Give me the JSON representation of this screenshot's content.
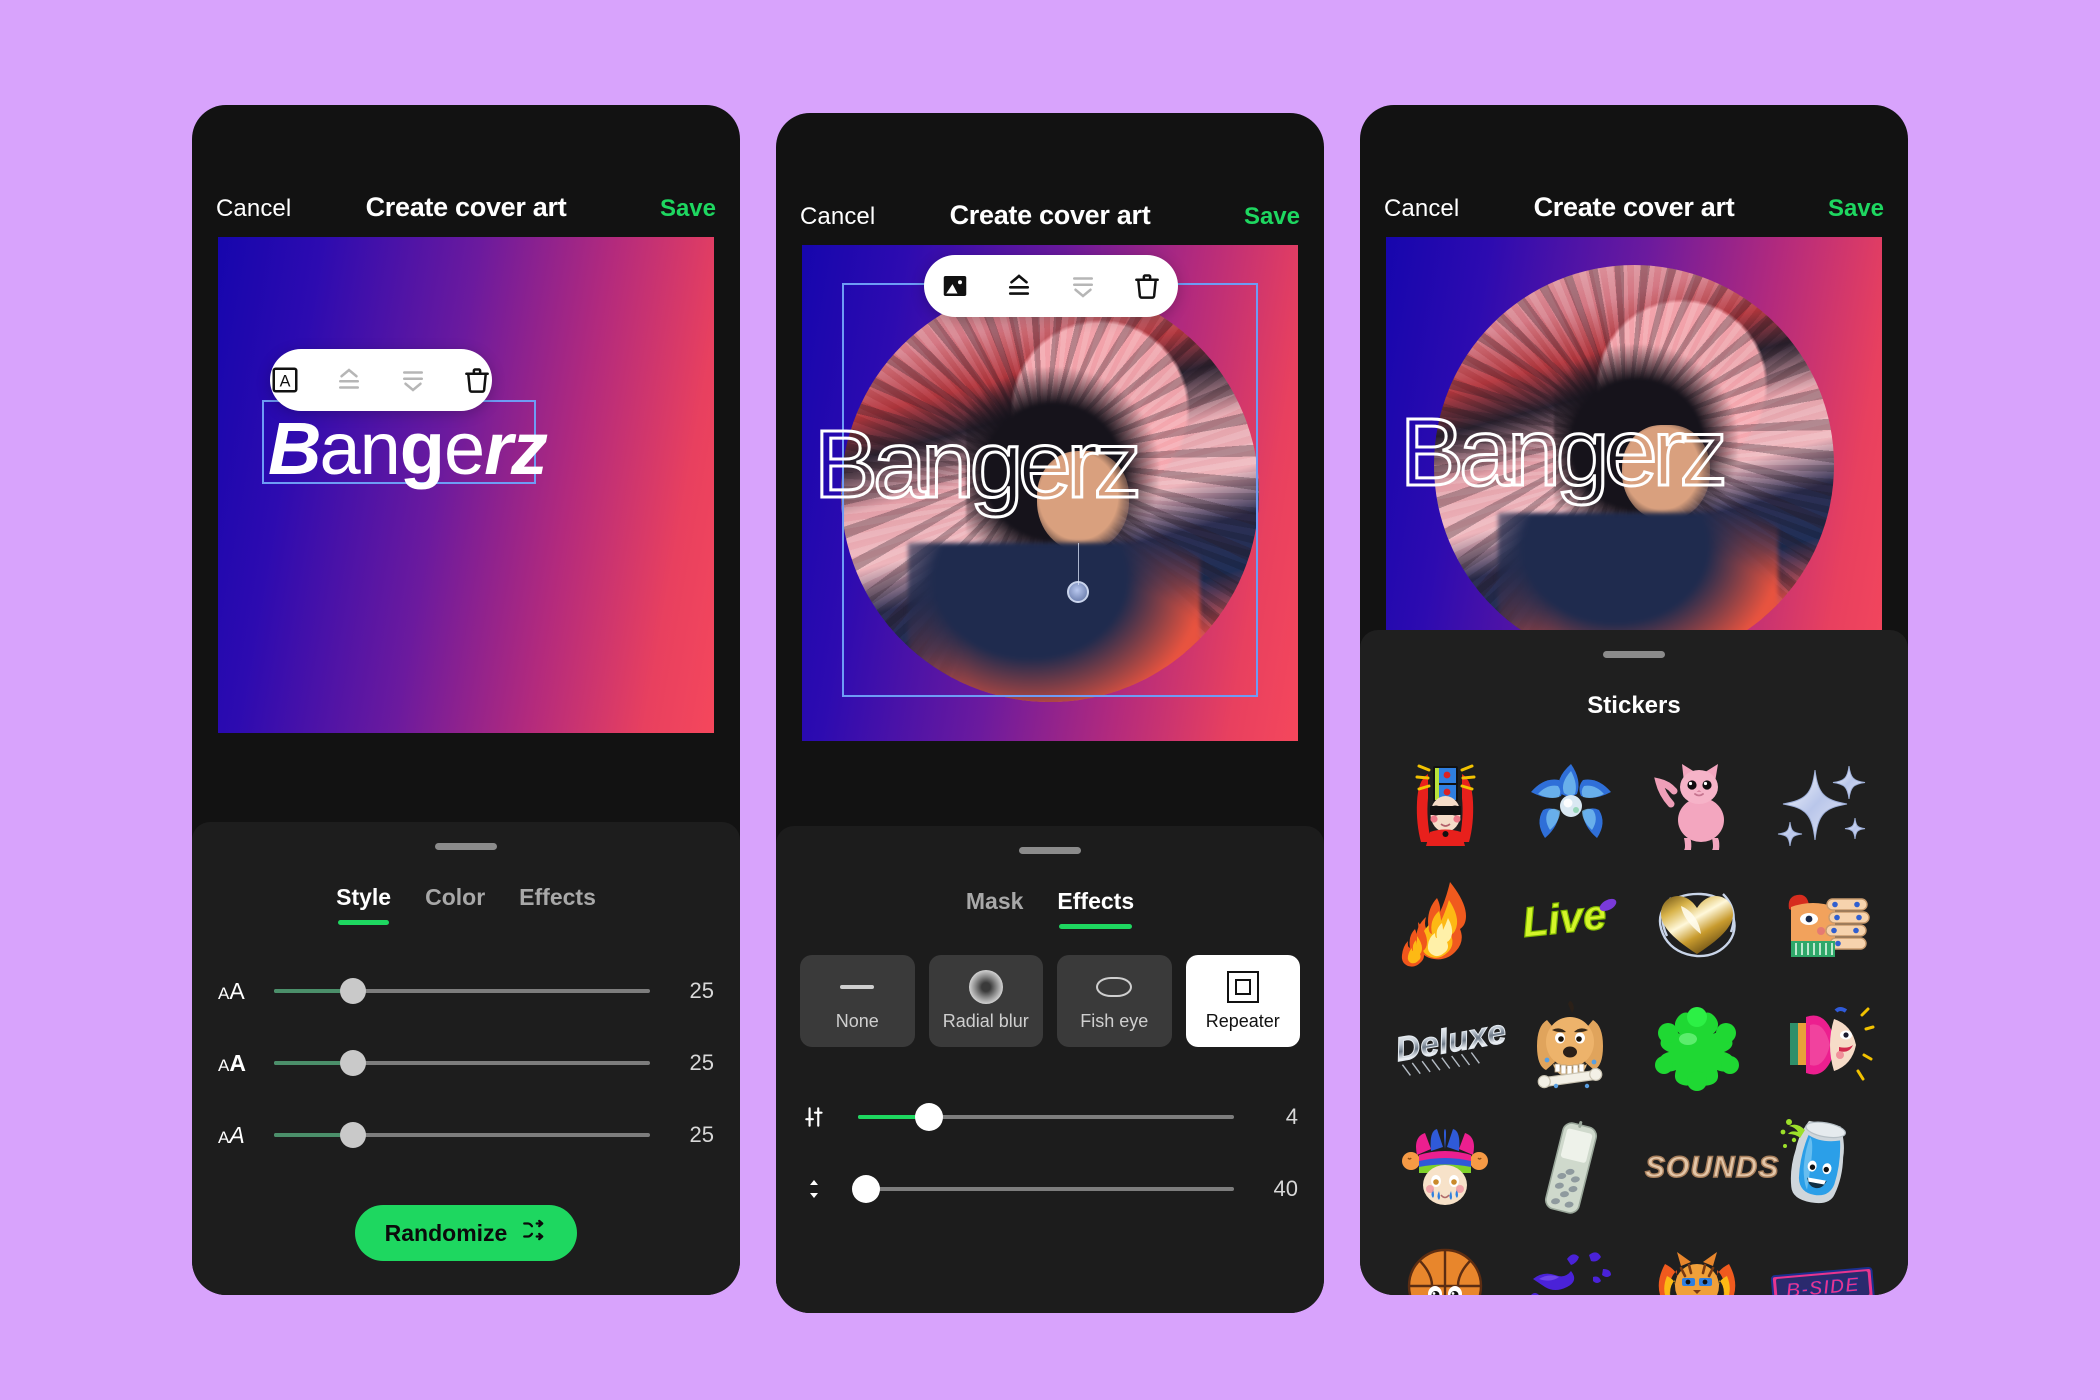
{
  "background_color": "#d8a3fc",
  "accent_green": "#1ed760",
  "screens": [
    {
      "id": "text-style",
      "header": {
        "cancel": "Cancel",
        "title": "Create cover art",
        "save": "Save"
      },
      "canvas": {
        "type": "gradient",
        "gradient_from": "#1606ad",
        "gradient_to": "#f5475c",
        "text_layer": {
          "value": "Bangerz",
          "parts": [
            "B",
            "an",
            "g",
            "e",
            "rz"
          ],
          "selected": true
        }
      },
      "toolbar": {
        "items": [
          {
            "icon": "text-box-icon",
            "label": "Text",
            "active": true
          },
          {
            "icon": "bring-forward-icon",
            "label": "Bring forward",
            "active": false
          },
          {
            "icon": "send-backward-icon",
            "label": "Send backward",
            "active": false
          },
          {
            "icon": "trash-icon",
            "label": "Delete",
            "active": true
          }
        ]
      },
      "sheet": {
        "tabs": [
          {
            "label": "Style",
            "active": true
          },
          {
            "label": "Color",
            "active": false
          },
          {
            "label": "Effects",
            "active": false
          }
        ],
        "sliders": [
          {
            "icon": "font-width-icon",
            "icon_text": "AA",
            "value": "25",
            "percent": 21
          },
          {
            "icon": "font-weight-icon",
            "icon_text": "AA",
            "value": "25",
            "percent": 21
          },
          {
            "icon": "font-slant-icon",
            "icon_text": "AA",
            "value": "25",
            "percent": 21
          }
        ],
        "randomize": {
          "label": "Randomize",
          "icon": "shuffle-icon"
        }
      }
    },
    {
      "id": "image-effects",
      "header": {
        "cancel": "Cancel",
        "title": "Create cover art",
        "save": "Save"
      },
      "canvas": {
        "type": "photo",
        "text_layer": {
          "value": "Bangerz",
          "outlined": true
        },
        "image_selected": true
      },
      "toolbar": {
        "items": [
          {
            "icon": "image-icon",
            "label": "Image",
            "active": true
          },
          {
            "icon": "bring-forward-icon",
            "label": "Bring forward",
            "active": true
          },
          {
            "icon": "send-backward-icon",
            "label": "Send backward",
            "active": false
          },
          {
            "icon": "trash-icon",
            "label": "Delete",
            "active": true
          }
        ]
      },
      "sheet": {
        "tabs": [
          {
            "label": "Mask",
            "active": false
          },
          {
            "label": "Effects",
            "active": true
          }
        ],
        "chips": [
          {
            "label": "None",
            "icon": "dash-icon",
            "active": false
          },
          {
            "label": "Radial blur",
            "icon": "radial-blur-icon",
            "active": false
          },
          {
            "label": "Fish eye",
            "icon": "fish-eye-icon",
            "active": false
          },
          {
            "label": "Repeater",
            "icon": "repeater-icon",
            "active": true
          }
        ],
        "sliders": [
          {
            "icon": "repeat-count-icon",
            "value": "4",
            "percent": 19
          },
          {
            "icon": "spacing-icon",
            "value": "40",
            "percent": 2
          }
        ]
      }
    },
    {
      "id": "stickers",
      "header": {
        "cancel": "Cancel",
        "title": "Create cover art",
        "save": "Save"
      },
      "canvas": {
        "type": "photo",
        "text_layer": {
          "value": "Bangerz",
          "outlined": true
        }
      },
      "sheet": {
        "title": "Stickers",
        "stickers": [
          {
            "name": "sticker-red-hair-character",
            "icon": "red-hair-sunglasses-icon"
          },
          {
            "name": "sticker-blue-flower",
            "icon": "blue-flower-icon"
          },
          {
            "name": "sticker-pink-cat",
            "icon": "pink-cat-icon"
          },
          {
            "name": "sticker-sparkles",
            "icon": "sparkles-icon"
          },
          {
            "name": "sticker-fire",
            "icon": "fire-icon"
          },
          {
            "name": "sticker-live-text",
            "icon": "live-text-icon",
            "text": "Live"
          },
          {
            "name": "sticker-gold-heart",
            "icon": "gold-heart-lightning-icon"
          },
          {
            "name": "sticker-face-fingers",
            "icon": "abstract-face-fingers-icon"
          },
          {
            "name": "sticker-chrome-text",
            "icon": "chrome-graffiti-icon",
            "text": "Deluxe"
          },
          {
            "name": "sticker-angry-dog",
            "icon": "angry-dog-bone-icon"
          },
          {
            "name": "sticker-green-splat",
            "icon": "green-splat-icon"
          },
          {
            "name": "sticker-magenta-face",
            "icon": "magenta-face-icon"
          },
          {
            "name": "sticker-jester-face",
            "icon": "jester-crying-face-icon"
          },
          {
            "name": "sticker-flip-phone",
            "icon": "flip-phone-icon"
          },
          {
            "name": "sticker-sounds-text",
            "icon": "sounds-text-icon",
            "text": "SOUNDS"
          },
          {
            "name": "sticker-soda-can",
            "icon": "blue-soda-can-face-icon"
          },
          {
            "name": "sticker-basketball-face",
            "icon": "basketball-face-icon"
          },
          {
            "name": "sticker-purple-splash",
            "icon": "purple-splash-icon"
          },
          {
            "name": "sticker-tiger-flames",
            "icon": "tiger-face-flames-icon"
          },
          {
            "name": "sticker-bside-text",
            "icon": "bside-text-icon",
            "text": "B-SIDE"
          }
        ]
      }
    }
  ]
}
